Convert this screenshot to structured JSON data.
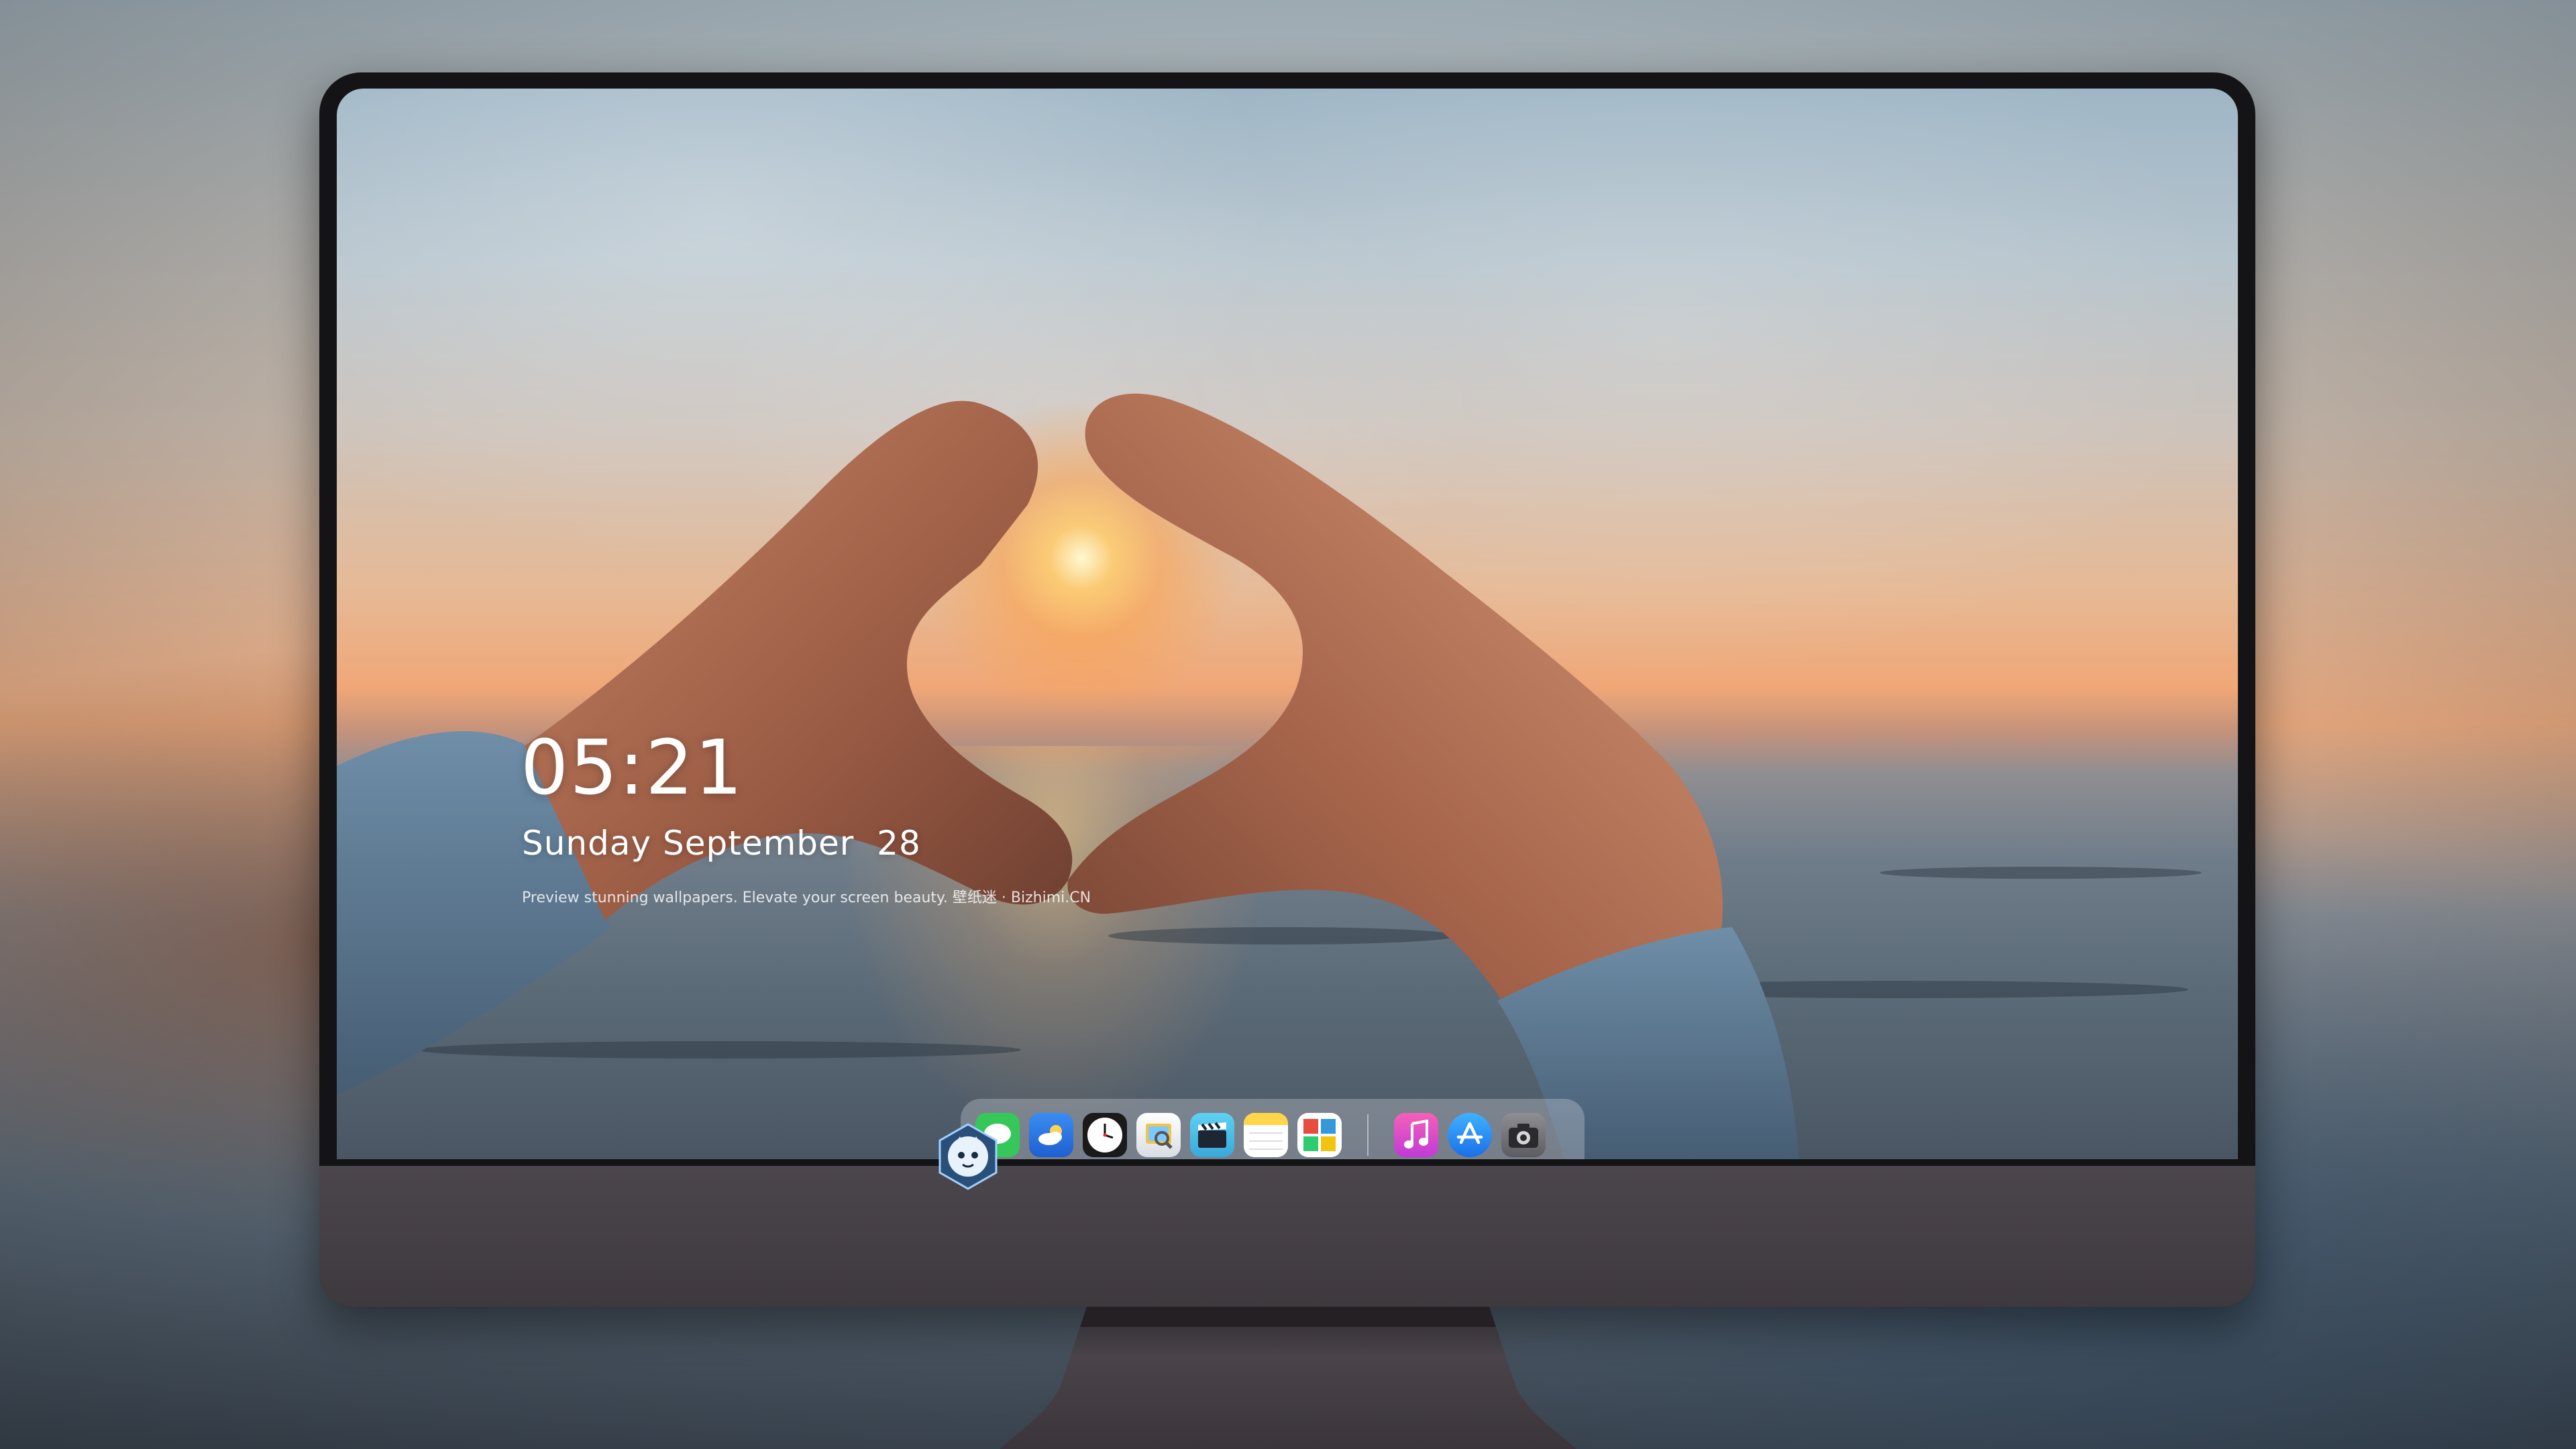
{
  "lock_screen": {
    "time": "05:21",
    "date": "Sunday September  28",
    "caption": "Preview stunning wallpapers. Elevate your screen beauty. 壁纸迷 · Bizhimi.CN"
  },
  "dock": {
    "apps": [
      {
        "name": "Messages",
        "icon": "messages-icon",
        "color": "#35c759"
      },
      {
        "name": "Weather",
        "icon": "weather-icon",
        "color": "#2f80ed"
      },
      {
        "name": "Clock",
        "icon": "clock-icon",
        "color": "#1a1a1a"
      },
      {
        "name": "Preview",
        "icon": "preview-icon",
        "color": "#f4c542"
      },
      {
        "name": "Clips",
        "icon": "clapperboard-icon",
        "color": "#4fc3e8"
      },
      {
        "name": "Notes",
        "icon": "notes-icon",
        "color": "#ffd54a"
      },
      {
        "name": "Photo Booth",
        "icon": "photo-booth-icon",
        "color": "#e74c3c"
      },
      {
        "name": "Music",
        "icon": "music-icon",
        "color": "#e948a5"
      },
      {
        "name": "App Store",
        "icon": "app-store-icon",
        "color": "#1e90ff"
      },
      {
        "name": "Screenshot",
        "icon": "camera-icon",
        "color": "#6d6d72"
      }
    ]
  }
}
